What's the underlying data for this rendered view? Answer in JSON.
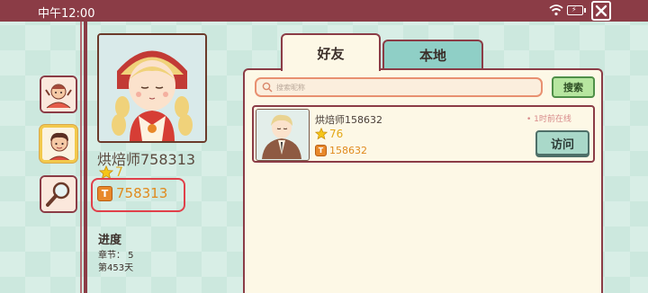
{
  "status_bar": {
    "time": "中午12:00",
    "battery_label": "⚡"
  },
  "profile": {
    "name": "烘焙师758313",
    "level": "7",
    "id": "758313",
    "coin_glyph": "T",
    "progress": {
      "title": "进度",
      "chapter": "章节： 5",
      "day": "第453天"
    }
  },
  "tabs": [
    {
      "label": "好友",
      "active": true
    },
    {
      "label": "本地",
      "active": false
    }
  ],
  "search": {
    "placeholder": "搜索昵称",
    "button_label": "搜索"
  },
  "friends": [
    {
      "name": "烘焙师158632",
      "level": "76",
      "id": "158632",
      "status": "• 1时前在线",
      "visit_label": "访问"
    }
  ],
  "colors": {
    "accent": "#8b3c46",
    "panel": "#fdf8e6",
    "tab_inactive": "#8fcfc6",
    "search_button": "#b7e6a0",
    "visit_button": "#a9d8c9",
    "highlight": "#e0404a"
  },
  "icons": {
    "side": [
      "person-emote-icon",
      "chef-avatar-icon",
      "magnifier-icon"
    ],
    "status": [
      "wifi-icon",
      "battery-icon",
      "close-icon"
    ]
  }
}
